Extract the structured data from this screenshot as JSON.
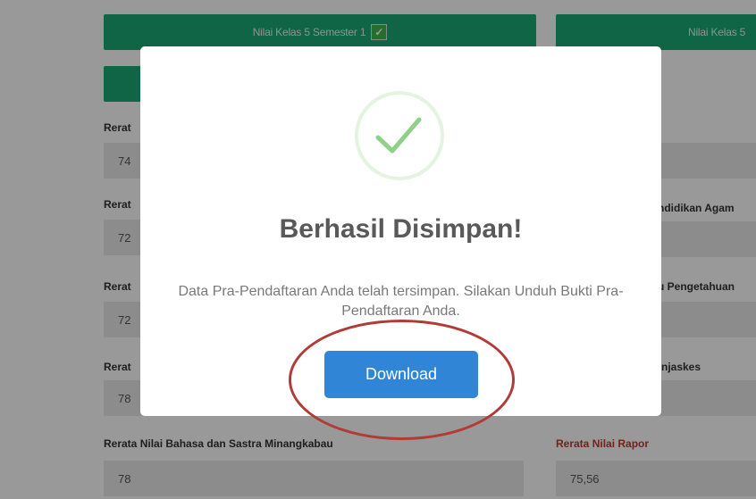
{
  "tabs": [
    {
      "label": "Nilai Kelas 5 Semester 1",
      "checked": true
    },
    {
      "label": "Nilai Kelas 5"
    }
  ],
  "left_fields": [
    {
      "label": "Rerat",
      "value": "74"
    },
    {
      "label": "Rerat",
      "value": "72"
    },
    {
      "label": "Rerat",
      "value": "72"
    },
    {
      "label": "Rerat",
      "value": "78"
    },
    {
      "label": "Rerata Nilai Bahasa dan Sastra Minangkabau",
      "value": "78"
    }
  ],
  "right_fields": [
    {
      "label": "",
      "value": ""
    },
    {
      "label": "ndidikan Agam",
      "value": ""
    },
    {
      "label": "u Pengetahuan",
      "value": ""
    },
    {
      "label": "njaskes",
      "value": ""
    },
    {
      "label": "Rerata Nilai Rapor",
      "value": "75,56",
      "highlight": true
    }
  ],
  "modal": {
    "icon": "success-check-icon",
    "title": "Berhasil Disimpan!",
    "text": "Data Pra-Pendaftaran Anda telah tersimpan. Silakan Unduh Bukti Pra-Pendaftaran Anda.",
    "button_label": "Download"
  },
  "colors": {
    "tab_green": "#1aa876",
    "button_blue": "#3085d6",
    "annotation_red": "#b23b38",
    "label_red": "#c0392b"
  }
}
